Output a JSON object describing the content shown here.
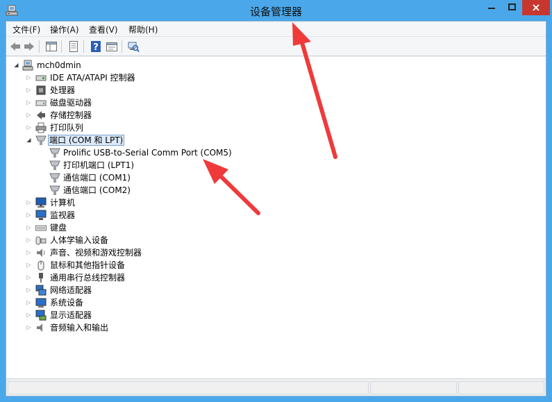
{
  "window": {
    "title": "设备管理器"
  },
  "menu": [
    {
      "label": "文件(F)"
    },
    {
      "label": "操作(A)"
    },
    {
      "label": "查看(V)"
    },
    {
      "label": "帮助(H)"
    }
  ],
  "toolbar": {
    "icons": [
      "back-icon",
      "forward-icon",
      "show-hide-tree-icon",
      "properties-icon",
      "help-icon",
      "device-view-icon",
      "scan-hardware-icon"
    ]
  },
  "tree": {
    "root": {
      "label": "mch0dmin"
    },
    "nodes": [
      {
        "label": "IDE ATA/ATAPI 控制器",
        "icon": "ide-controller-icon"
      },
      {
        "label": "处理器",
        "icon": "processor-icon"
      },
      {
        "label": "磁盘驱动器",
        "icon": "disk-drive-icon"
      },
      {
        "label": "存储控制器",
        "icon": "storage-controller-icon"
      },
      {
        "label": "打印队列",
        "icon": "printer-icon"
      },
      {
        "label": "端口 (COM 和 LPT)",
        "icon": "port-icon",
        "expanded": true,
        "selected": true,
        "children": [
          {
            "label": "Prolific USB-to-Serial Comm Port (COM5)",
            "icon": "port-icon"
          },
          {
            "label": "打印机端口 (LPT1)",
            "icon": "port-icon"
          },
          {
            "label": "通信端口 (COM1)",
            "icon": "port-icon"
          },
          {
            "label": "通信端口 (COM2)",
            "icon": "port-icon"
          }
        ]
      },
      {
        "label": "计算机",
        "icon": "computer-icon"
      },
      {
        "label": "监视器",
        "icon": "monitor-icon"
      },
      {
        "label": "键盘",
        "icon": "keyboard-icon"
      },
      {
        "label": "人体学输入设备",
        "icon": "hid-icon"
      },
      {
        "label": "声音、视频和游戏控制器",
        "icon": "speaker-icon"
      },
      {
        "label": "鼠标和其他指针设备",
        "icon": "mouse-icon"
      },
      {
        "label": "通用串行总线控制器",
        "icon": "usb-icon"
      },
      {
        "label": "网络适配器",
        "icon": "network-adapter-icon"
      },
      {
        "label": "系统设备",
        "icon": "system-device-icon"
      },
      {
        "label": "显示适配器",
        "icon": "display-adapter-icon"
      },
      {
        "label": "音频输入和输出",
        "icon": "audio-io-icon"
      }
    ]
  },
  "colors": {
    "frame": "#4aa8ea",
    "close": "#c7372f",
    "selection": "#dbe9f8",
    "annotation_arrow": "#f03a3a"
  }
}
